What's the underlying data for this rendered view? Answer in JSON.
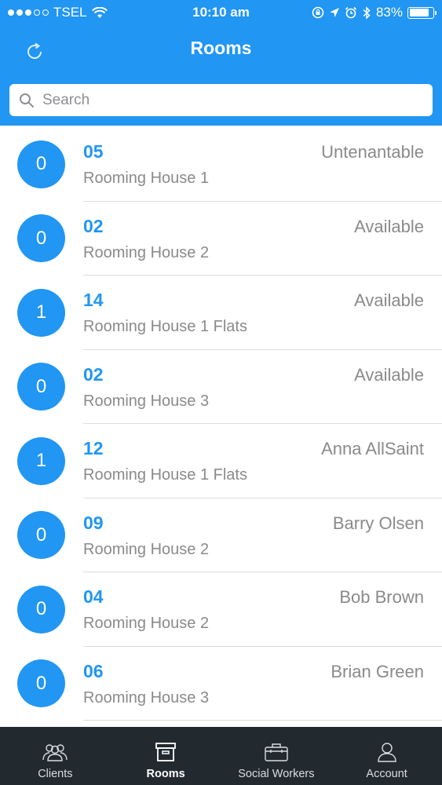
{
  "status_bar": {
    "carrier": "TSEL",
    "time": "10:10 am",
    "battery": "83%",
    "battery_level": 0.83
  },
  "header": {
    "title": "Rooms",
    "refresh_icon": "refresh-icon"
  },
  "search": {
    "placeholder": "Search",
    "value": ""
  },
  "rooms": [
    {
      "count": "0",
      "number": "05",
      "house": "Rooming House 1",
      "status": "Untenantable"
    },
    {
      "count": "0",
      "number": "02",
      "house": "Rooming House 2",
      "status": "Available"
    },
    {
      "count": "1",
      "number": "14",
      "house": "Rooming House 1 Flats",
      "status": "Available"
    },
    {
      "count": "0",
      "number": "02",
      "house": "Rooming House 3",
      "status": "Available"
    },
    {
      "count": "1",
      "number": "12",
      "house": "Rooming House 1 Flats",
      "status": "Anna AllSaint"
    },
    {
      "count": "0",
      "number": "09",
      "house": "Rooming House 2",
      "status": "Barry Olsen"
    },
    {
      "count": "0",
      "number": "04",
      "house": "Rooming House 2",
      "status": "Bob Brown"
    },
    {
      "count": "0",
      "number": "06",
      "house": "Rooming House 3",
      "status": "Brian Green"
    }
  ],
  "tabs": [
    {
      "label": "Clients",
      "icon": "clients-icon",
      "active": false
    },
    {
      "label": "Rooms",
      "icon": "rooms-icon",
      "active": true
    },
    {
      "label": "Social Workers",
      "icon": "briefcase-icon",
      "active": false
    },
    {
      "label": "Account",
      "icon": "account-icon",
      "active": false
    }
  ],
  "colors": {
    "accent": "#2196F3",
    "tab_bar": "#232a2f",
    "secondary_text": "#8a8a8a"
  }
}
